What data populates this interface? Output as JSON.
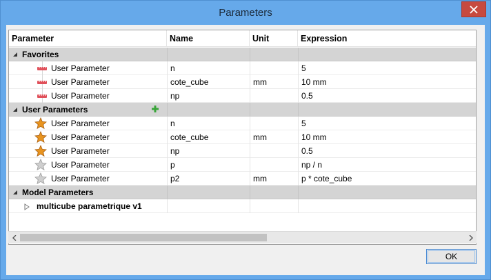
{
  "window": {
    "title": "Parameters"
  },
  "columns": [
    "Parameter",
    "Name",
    "Unit",
    "Expression"
  ],
  "groups": {
    "favorites": {
      "label": "Favorites",
      "rows": [
        {
          "parameter": "User Parameter",
          "name": "n",
          "unit": "",
          "expression": "5",
          "icon": "ruler-icon"
        },
        {
          "parameter": "User Parameter",
          "name": "cote_cube",
          "unit": "mm",
          "expression": "10 mm",
          "icon": "ruler-icon"
        },
        {
          "parameter": "User Parameter",
          "name": "np",
          "unit": "",
          "expression": "0.5",
          "icon": "ruler-icon"
        }
      ]
    },
    "user": {
      "label": "User Parameters",
      "rows": [
        {
          "parameter": "User Parameter",
          "name": "n",
          "unit": "",
          "expression": "5",
          "icon": "star-favorite-icon"
        },
        {
          "parameter": "User Parameter",
          "name": "cote_cube",
          "unit": "mm",
          "expression": "10 mm",
          "icon": "star-favorite-icon"
        },
        {
          "parameter": "User Parameter",
          "name": "np",
          "unit": "",
          "expression": "0.5",
          "icon": "star-favorite-icon"
        },
        {
          "parameter": "User Parameter",
          "name": "p",
          "unit": "",
          "expression": "np / n",
          "icon": "star-icon"
        },
        {
          "parameter": "User Parameter",
          "name": "p2",
          "unit": "mm",
          "expression": "p * cote_cube",
          "icon": "star-icon"
        }
      ]
    },
    "model": {
      "label": "Model Parameters",
      "rows": [
        {
          "parameter": "multicube parametrique v1",
          "icon": "expand-triangle-icon"
        }
      ]
    }
  },
  "buttons": {
    "ok": "OK"
  },
  "colors": {
    "titlebar": "#66a9ea",
    "close": "#c74a3f",
    "group_row": "#d4d4d4",
    "star_orange": "#e8941f",
    "ruler_red": "#e0505a",
    "add_green": "#3aa53a"
  }
}
